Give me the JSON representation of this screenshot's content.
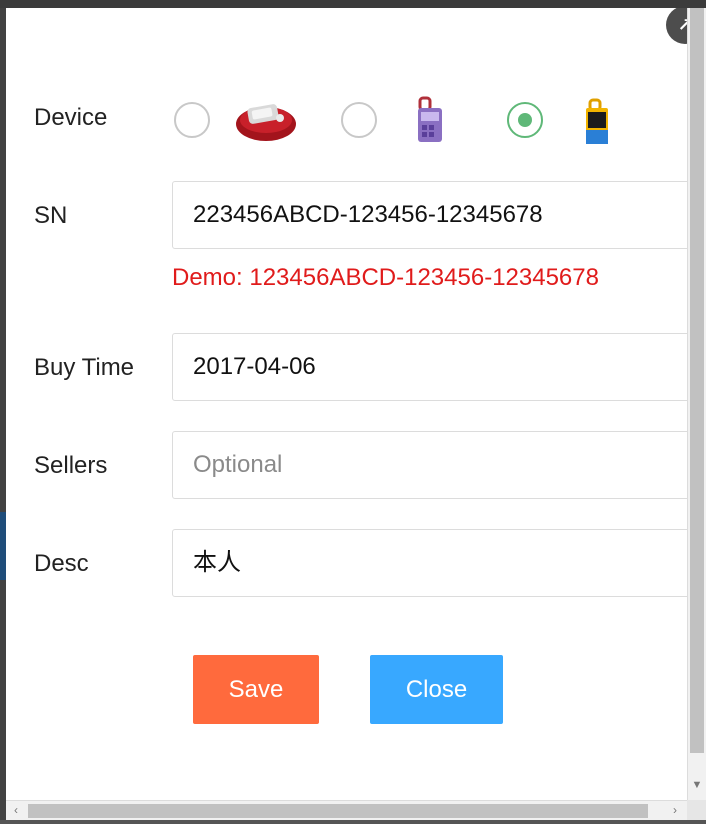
{
  "form": {
    "device_label": "Device",
    "sn_label": "SN",
    "sn_value": "223456ABCD-123456-12345678",
    "demo_text": "Demo: 123456ABCD-123456-12345678",
    "buy_time_label": "Buy Time",
    "buy_time_value": "2017-04-06",
    "sellers_label": "Sellers",
    "sellers_placeholder": "Optional",
    "desc_label": "Desc",
    "desc_value": "本人"
  },
  "device_options": [
    {
      "icon": "red-device-icon",
      "selected": false
    },
    {
      "icon": "purple-key-tool-icon",
      "selected": false
    },
    {
      "icon": "blue-yellow-key-tool-icon",
      "selected": true
    }
  ],
  "buttons": {
    "save_label": "Save",
    "close_label": "Close"
  },
  "colors": {
    "save": "#ff6a3d",
    "close": "#38a8ff",
    "radio_checked": "#5fb878",
    "demo_text": "#e01b1b"
  }
}
